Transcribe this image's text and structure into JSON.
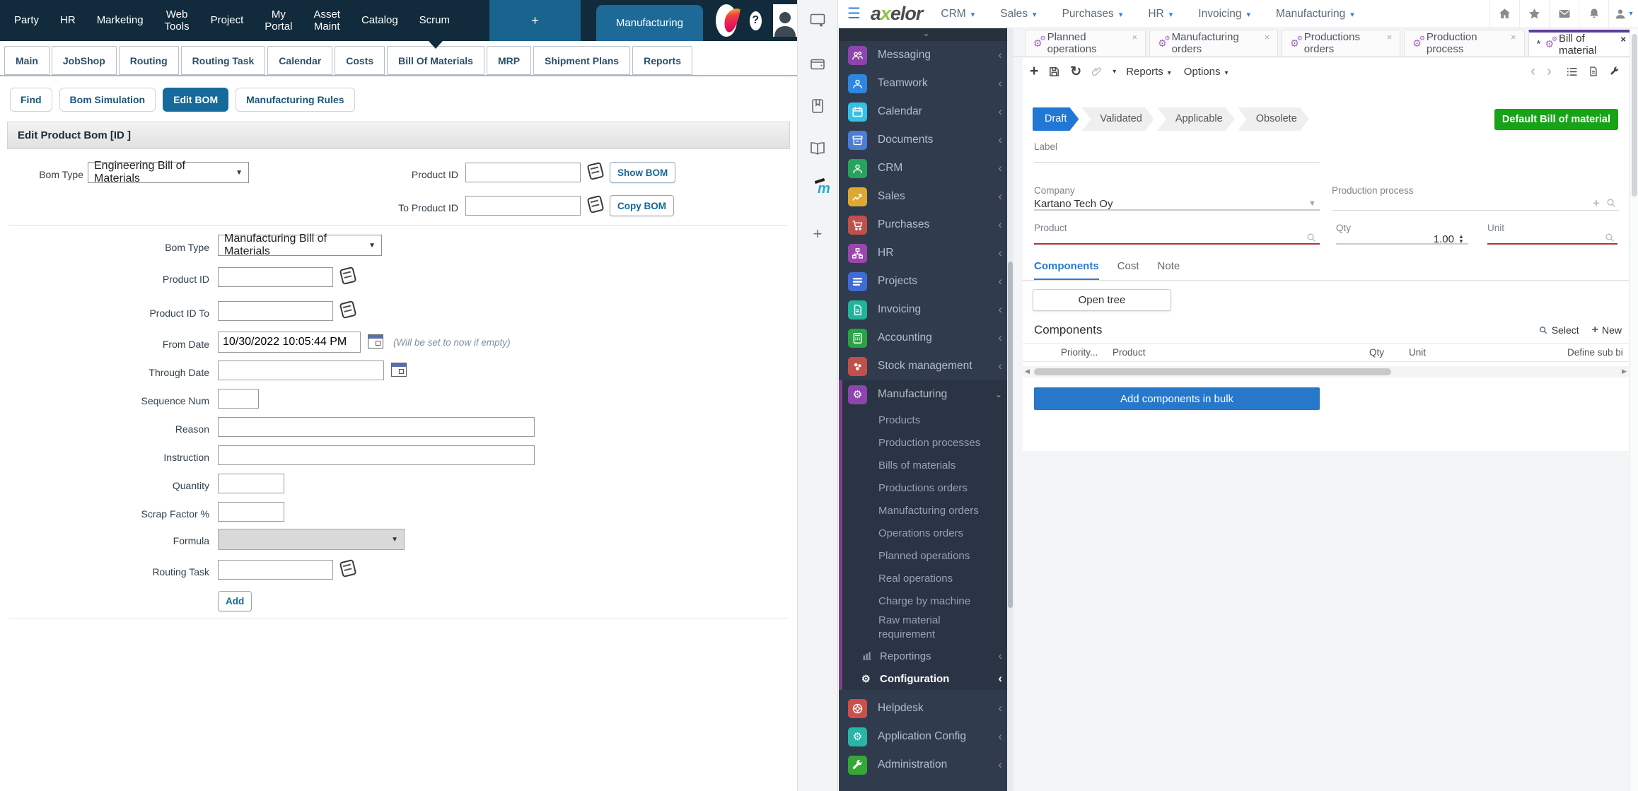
{
  "colors": {
    "ofbiz_topbar": "#112b3c",
    "ofbiz_accent": "#1d6a99",
    "ofbiz_link": "#17689b",
    "axelor_blue": "#2f7ed8",
    "axelor_logo_green": "#8dc63f",
    "tab_active_purple": "#5d3e99",
    "tab_cog_purple": "#a569bd",
    "status_active_blue": "#2077d4",
    "badge_green": "#17a317",
    "required_red": "#b23430",
    "bulk_button_blue": "#2778cb",
    "components_tab_blue": "#2b7bd2",
    "sidebar_bg": "#303c4d",
    "sidebar_section_bg": "#2a3444",
    "sidebar_purple_border": "#7d3f98"
  },
  "ofbiz": {
    "topnav": {
      "items": [
        "Party",
        "HR",
        "Marketing",
        "Web\nTools",
        "Project",
        "My\nPortal",
        "Asset\nMaint",
        "Catalog",
        "Scrum"
      ],
      "new_tab": "+",
      "active_app": "Manufacturing",
      "help": "?"
    },
    "tabs": {
      "items": [
        "Main",
        "JobShop",
        "Routing",
        "Routing Task",
        "Calendar",
        "Costs",
        "Bill Of Materials",
        "MRP",
        "Shipment Plans",
        "Reports"
      ],
      "active": "Bill Of Materials"
    },
    "subtabs": {
      "items": [
        "Find",
        "Bom Simulation",
        "Edit BOM",
        "Manufacturing Rules"
      ],
      "active": "Edit BOM"
    },
    "screen_title": "Edit Product Bom  [ID ]",
    "find_form": {
      "bom_type_label": "Bom Type",
      "bom_type_value": "Engineering Bill of Materials",
      "product_id_label": "Product ID",
      "show_bom_button": "Show BOM",
      "to_product_id_label": "To Product ID",
      "copy_bom_button": "Copy BOM"
    },
    "edit_form": {
      "bom_type_label": "Bom Type",
      "bom_type_value": "Manufacturing Bill of Materials",
      "product_id_label": "Product ID",
      "product_id_to_label": "Product ID To",
      "from_date_label": "From Date",
      "from_date_value": "10/30/2022 10:05:44 PM",
      "from_date_note": "(Will be set to now if empty)",
      "through_date_label": "Through Date",
      "sequence_num_label": "Sequence Num",
      "reason_label": "Reason",
      "instruction_label": "Instruction",
      "quantity_label": "Quantity",
      "scrap_factor_label": "Scrap Factor %",
      "formula_label": "Formula",
      "routing_task_label": "Routing Task",
      "add_button": "Add"
    }
  },
  "launcher": {
    "icons": [
      "screen-share-icon",
      "wallet-icon",
      "book-icon",
      "open-book-icon",
      "moodle-icon",
      "plus-icon"
    ],
    "moodle_letter": "m",
    "plus": "+"
  },
  "axelor": {
    "navbar": {
      "logo_a": "a",
      "logo_x": "x",
      "logo_rest": "elor",
      "menus": [
        "CRM",
        "Sales",
        "Purchases",
        "HR",
        "Invoicing",
        "Manufacturing"
      ]
    },
    "tabs": {
      "items": [
        {
          "label": "Planned operations"
        },
        {
          "label": "Manufacturing orders"
        },
        {
          "label": "Productions orders"
        },
        {
          "label": "Production process"
        },
        {
          "label": "Bill of material",
          "active": true,
          "dirty": "*"
        }
      ]
    },
    "toolbar": {
      "reports": "Reports",
      "options": "Options"
    },
    "status": {
      "steps": [
        "Draft",
        "Validated",
        "Applicable",
        "Obsolete"
      ],
      "active": "Draft",
      "badge": "Default Bill of material"
    },
    "form": {
      "label_label": "Label",
      "company_label": "Company",
      "company_value": "Kartano Tech Oy",
      "production_process_label": "Production process",
      "product_label": "Product",
      "qty_label": "Qty",
      "qty_value": "1.00",
      "unit_label": "Unit"
    },
    "detail_tabs": {
      "items": [
        "Components",
        "Cost",
        "Note"
      ],
      "active": "Components"
    },
    "open_tree_button": "Open tree",
    "components": {
      "title": "Components",
      "select_link": "Select",
      "new_link": "New",
      "columns": [
        "Priority...",
        "Product",
        "Qty",
        "Unit",
        "Define sub bi"
      ],
      "bulk_button": "Add components in bulk"
    },
    "sidebar": {
      "items": [
        {
          "label": "Messaging",
          "icon": "people-icon",
          "color": "#8e44ad"
        },
        {
          "label": "Teamwork",
          "icon": "person-icon",
          "color": "#2e86de"
        },
        {
          "label": "Calendar",
          "icon": "calendar-icon",
          "color": "#34c1e8"
        },
        {
          "label": "Documents",
          "icon": "archive-icon",
          "color": "#4a7dd8"
        },
        {
          "label": "CRM",
          "icon": "person-icon",
          "color": "#28a35c"
        },
        {
          "label": "Sales",
          "icon": "chart-icon",
          "color": "#dda92f"
        },
        {
          "label": "Purchases",
          "icon": "cart-icon",
          "color": "#c0504a"
        },
        {
          "label": "HR",
          "icon": "orgtree-icon",
          "color": "#9b46ad"
        },
        {
          "label": "Projects",
          "icon": "list-icon",
          "color": "#3f6ad8"
        },
        {
          "label": "Invoicing",
          "icon": "document-icon",
          "color": "#21b49a"
        },
        {
          "label": "Accounting",
          "icon": "calculator-icon",
          "color": "#2aa246"
        },
        {
          "label": "Stock management",
          "icon": "stock-icon",
          "color": "#c05048"
        },
        {
          "label": "Manufacturing",
          "icon": "cogs-icon",
          "color": "#8e44ad",
          "expanded": true
        }
      ],
      "manufacturing_children": [
        "Products",
        "Production processes",
        "Bills of materials",
        "Productions orders",
        "Manufacturing orders",
        "Operations orders",
        "Planned operations",
        "Real operations",
        "Charge by machine",
        "Raw material requirement"
      ],
      "section_extra": [
        {
          "label": "Reportings",
          "icon": "bar-chart-icon"
        },
        {
          "label": "Configuration",
          "icon": "gear-icon"
        }
      ],
      "bottom_items": [
        {
          "label": "Helpdesk",
          "icon": "lifebuoy-icon",
          "color": "#cd4f4b"
        },
        {
          "label": "Application Config",
          "icon": "gear-icon",
          "color": "#2bb5a8"
        },
        {
          "label": "Administration",
          "icon": "wrench-icon",
          "color": "#35a735"
        }
      ]
    }
  }
}
